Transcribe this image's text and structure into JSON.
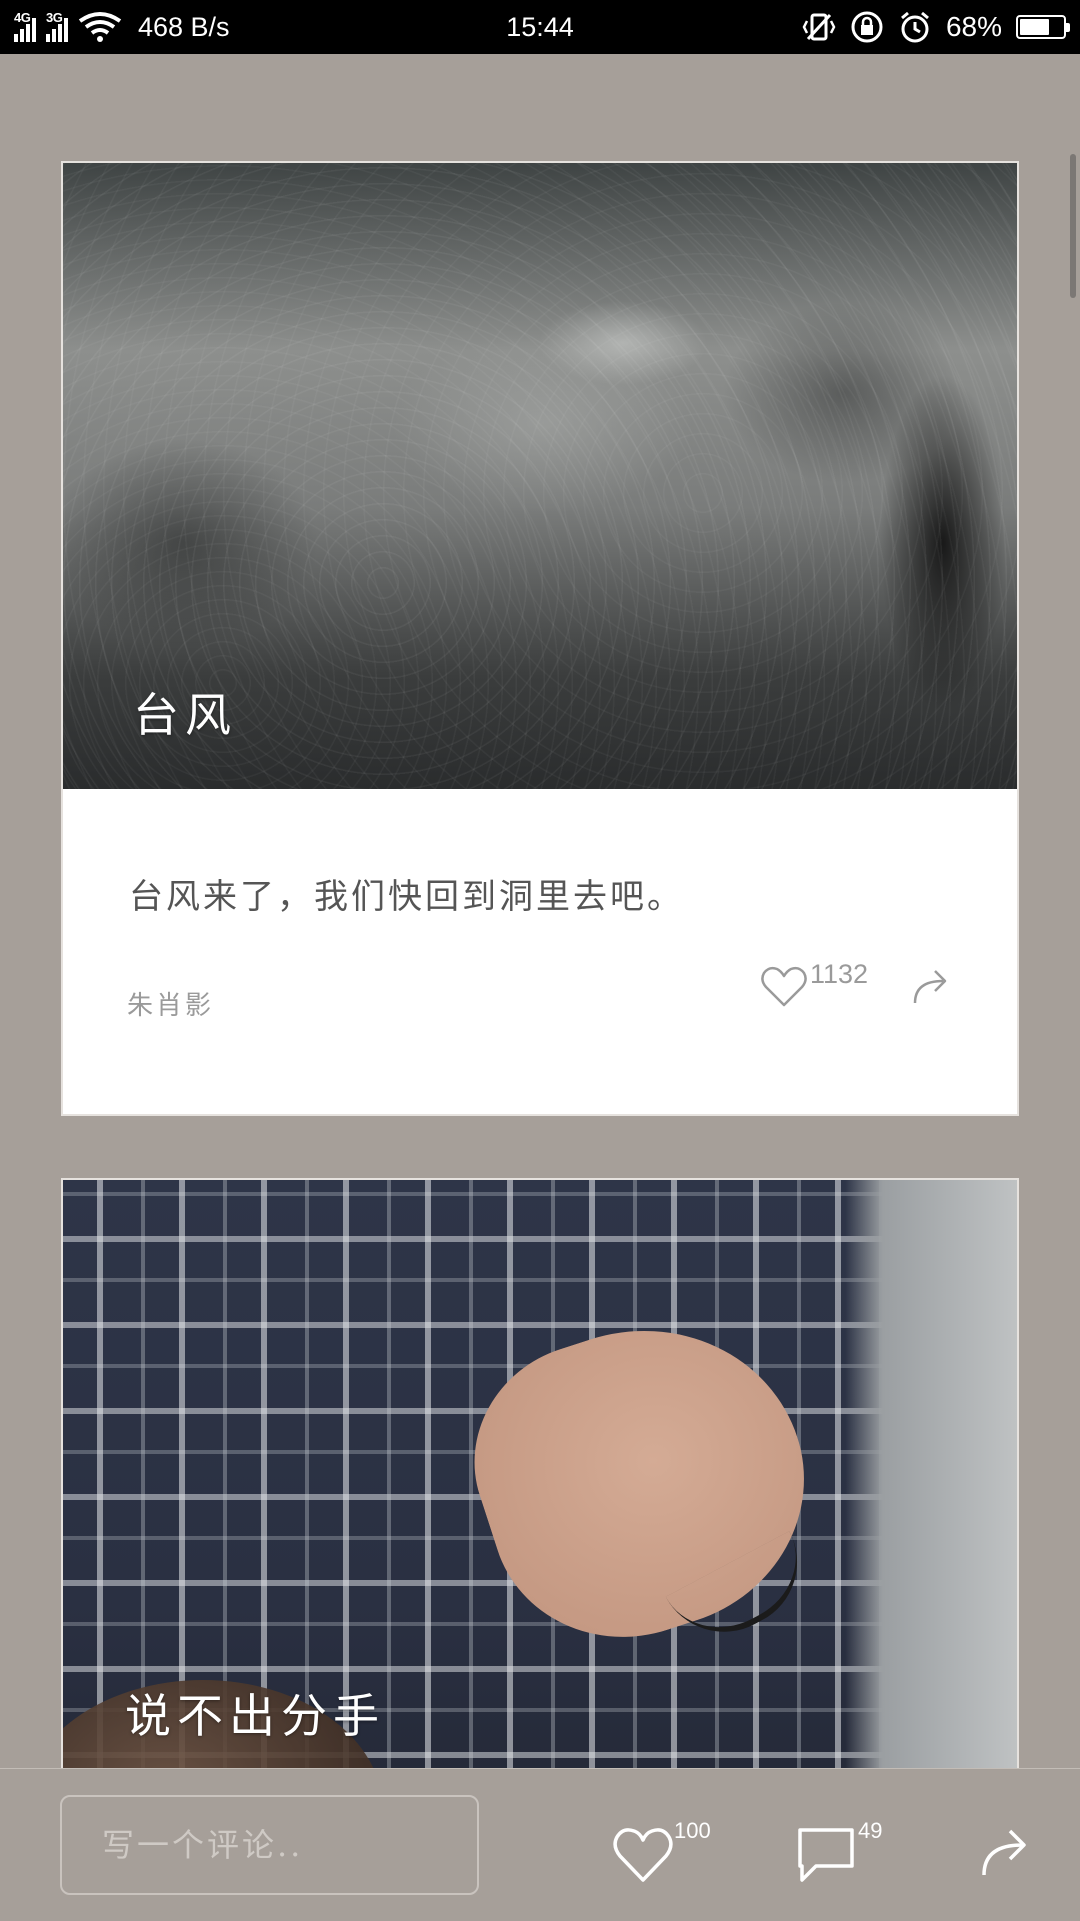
{
  "status_bar": {
    "network_1": "4G",
    "network_2": "3G",
    "speed": "468 B/s",
    "time": "15:44",
    "battery_percent": "68%",
    "battery_level": 0.68,
    "icons": [
      "wifi-icon",
      "vibrate-icon",
      "rotation-lock-icon",
      "alarm-icon",
      "battery-icon"
    ]
  },
  "feed": {
    "cards": [
      {
        "title": "台风",
        "text": "台风来了，我们快回到洞里去吧。",
        "author": "朱肖影",
        "likes": "1132"
      },
      {
        "title": "说不出分手"
      }
    ]
  },
  "bottom_bar": {
    "comment_placeholder": "写一个评论..",
    "likes": "100",
    "comments": "49"
  },
  "colors": {
    "background": "#a69f99",
    "status_bar": "#000000",
    "card": "#ffffff",
    "muted_text": "#9a9a9a"
  }
}
